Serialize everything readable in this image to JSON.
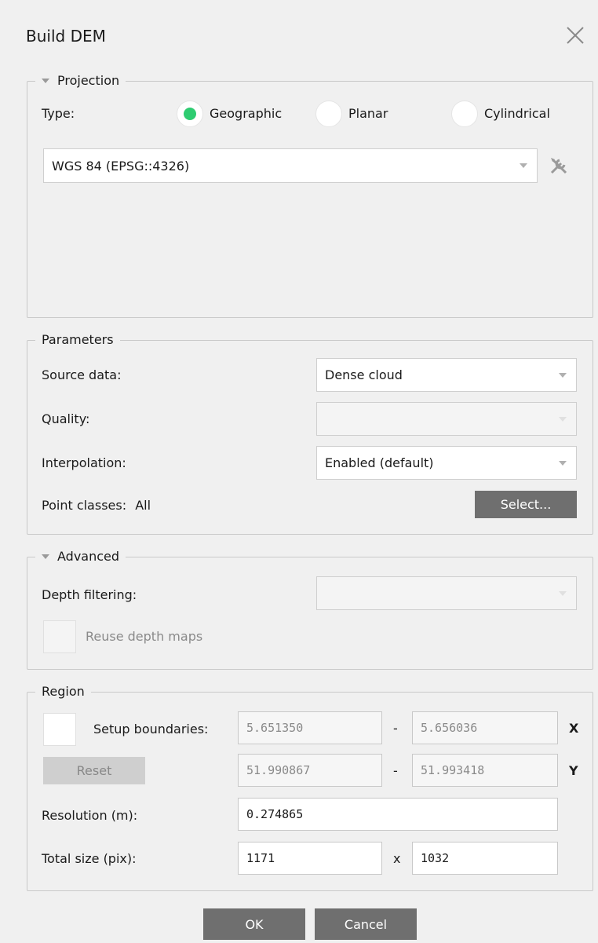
{
  "dialog": {
    "title": "Build DEM",
    "close_icon": "close-icon"
  },
  "projection": {
    "legend": "Projection",
    "type_label": "Type:",
    "types": [
      {
        "label": "Geographic",
        "selected": true
      },
      {
        "label": "Planar",
        "selected": false
      },
      {
        "label": "Cylindrical",
        "selected": false
      }
    ],
    "crs_value": "WGS 84 (EPSG::4326)",
    "tools_icon": "tools-icon"
  },
  "parameters": {
    "legend": "Parameters",
    "source_label": "Source data:",
    "source_value": "Dense cloud",
    "quality_label": "Quality:",
    "quality_value": "",
    "interp_label": "Interpolation:",
    "interp_value": "Enabled (default)",
    "point_classes_label": "Point classes:",
    "point_classes_value": "All",
    "select_button": "Select..."
  },
  "advanced": {
    "legend": "Advanced",
    "depth_label": "Depth filtering:",
    "depth_value": "",
    "reuse_label": "Reuse depth maps"
  },
  "region": {
    "legend": "Region",
    "setup_label": "Setup boundaries:",
    "x_min": "5.651350",
    "x_max": "5.656036",
    "x_axis": "X",
    "y_min": "51.990867",
    "y_max": "51.993418",
    "y_axis": "Y",
    "dash": "-",
    "reset_button": "Reset",
    "resolution_label": "Resolution (m):",
    "resolution_value": "0.274865",
    "total_label": "Total size (pix):",
    "total_w": "1171",
    "times": "x",
    "total_h": "1032"
  },
  "footer": {
    "ok": "OK",
    "cancel": "Cancel"
  },
  "colors": {
    "accent": "#2ecc71",
    "button": "#6f6f6f"
  }
}
